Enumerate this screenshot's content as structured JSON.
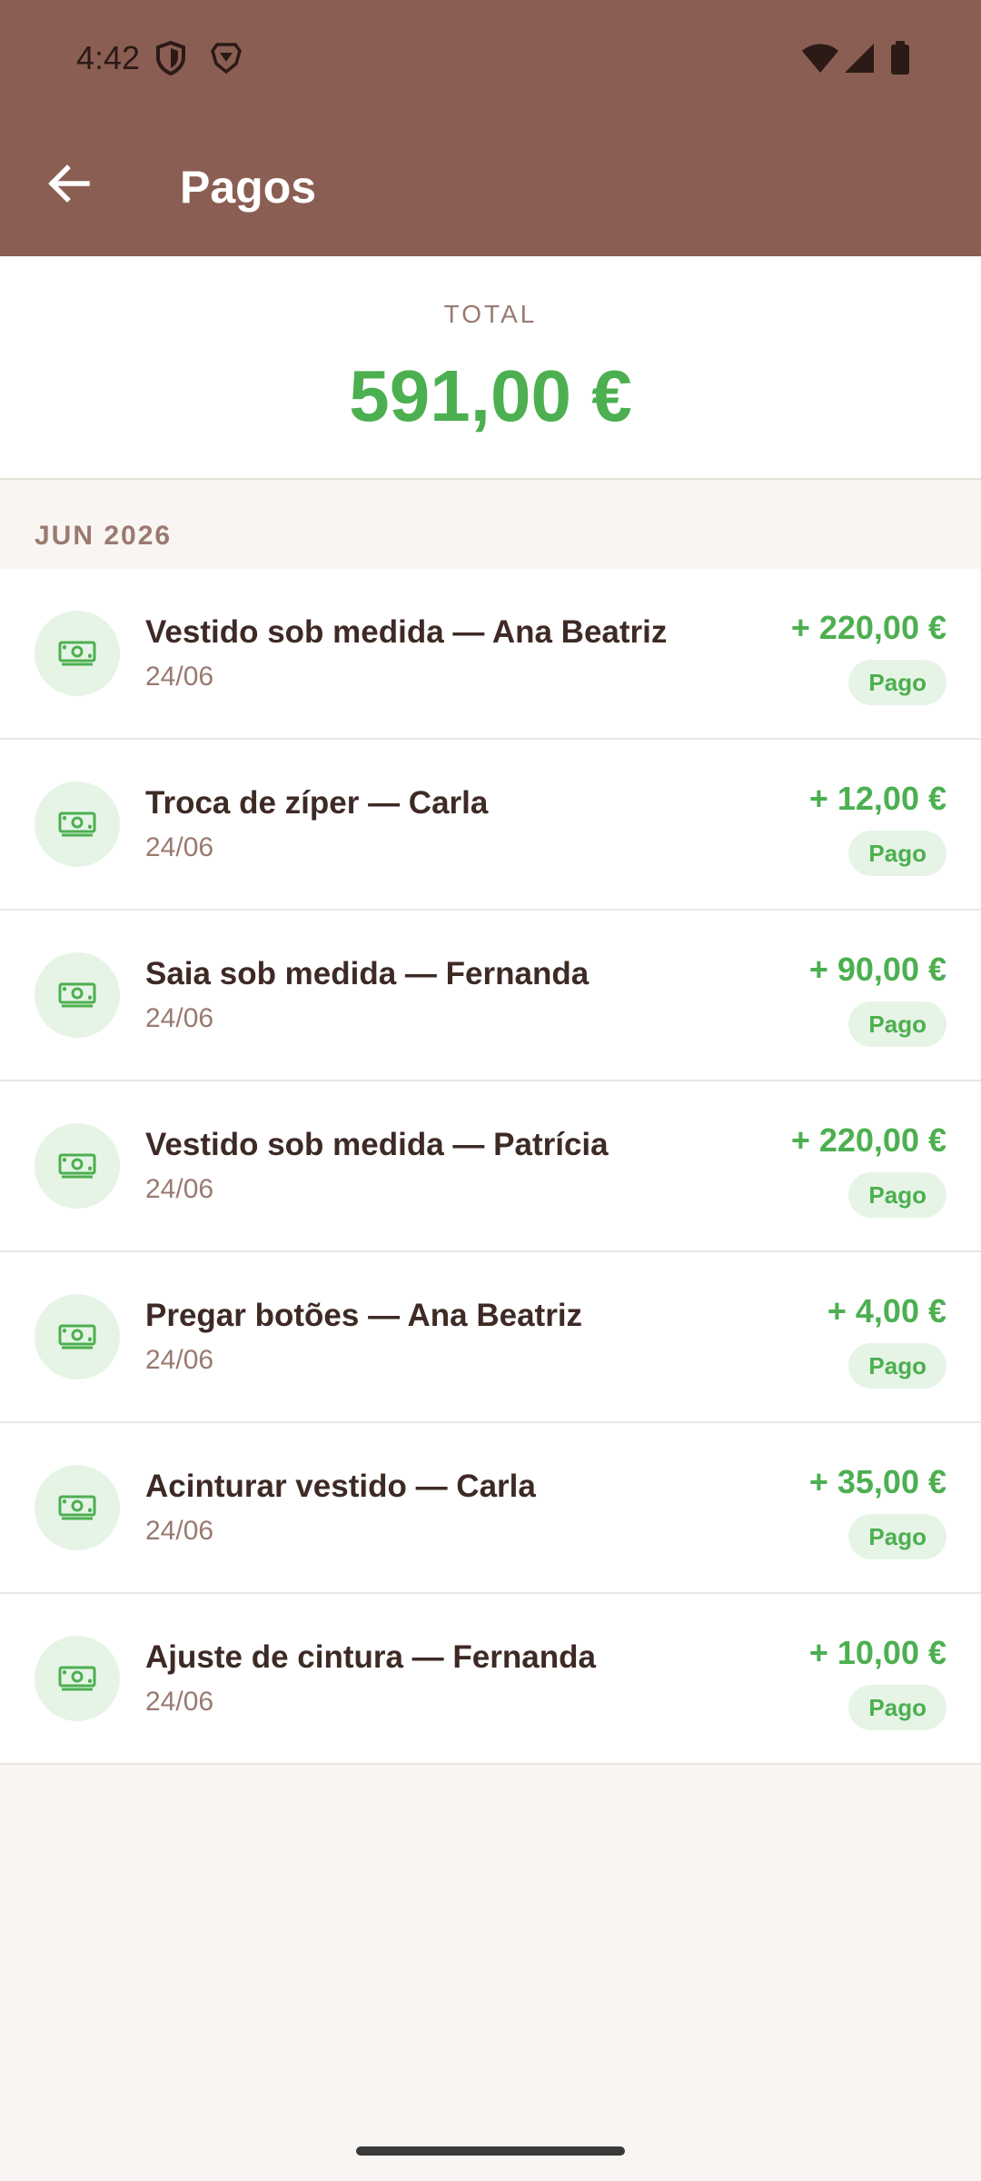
{
  "status_bar": {
    "time": "4:42",
    "icons": [
      "shield-icon",
      "brave-icon",
      "wifi-icon",
      "signal-icon",
      "battery-icon"
    ]
  },
  "header": {
    "back_icon": "arrow-back-icon",
    "title": "Pagos"
  },
  "total": {
    "label": "TOTAL",
    "value": "591,00 €"
  },
  "section": {
    "month": "JUN 2026"
  },
  "payments": [
    {
      "title": "Vestido sob medida — Ana Beatriz",
      "date": "24/06",
      "amount": "+ 220,00 €",
      "status": "Pago"
    },
    {
      "title": "Troca de zíper — Carla",
      "date": "24/06",
      "amount": "+ 12,00 €",
      "status": "Pago"
    },
    {
      "title": "Saia sob medida — Fernanda",
      "date": "24/06",
      "amount": "+ 90,00 €",
      "status": "Pago"
    },
    {
      "title": "Vestido sob medida — Patrícia",
      "date": "24/06",
      "amount": "+ 220,00 €",
      "status": "Pago"
    },
    {
      "title": "Pregar botões — Ana Beatriz",
      "date": "24/06",
      "amount": "+ 4,00 €",
      "status": "Pago"
    },
    {
      "title": "Acinturar vestido — Carla",
      "date": "24/06",
      "amount": "+ 35,00 €",
      "status": "Pago"
    },
    {
      "title": "Ajuste de cintura — Fernanda",
      "date": "24/06",
      "amount": "+ 10,00 €",
      "status": "Pago"
    }
  ],
  "colors": {
    "app_bar": "#8b5e53",
    "accent_green": "#4caf50",
    "badge_bg": "#e6f4e6",
    "muted_text": "#9a7a70",
    "background": "#f9f5f2"
  }
}
